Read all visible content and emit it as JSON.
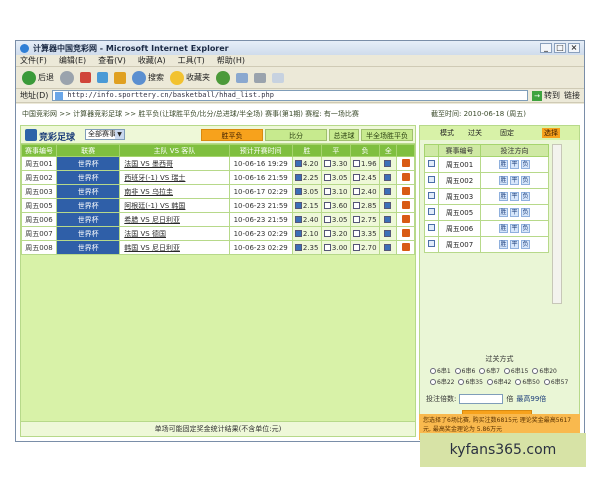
{
  "browser": {
    "title": "计算器中国竞彩网 - Microsoft Internet Explorer",
    "menu": [
      "文件(F)",
      "编辑(E)",
      "查看(V)",
      "收藏(A)",
      "工具(T)",
      "帮助(H)"
    ],
    "toolbar": {
      "back": "后退",
      "search": "搜索",
      "favorites": "收藏夹"
    },
    "address_label": "地址(D)",
    "url": "http://info.sporttery.cn/basketball/hhad_list.php",
    "go": "转到",
    "links": "链接"
  },
  "page": {
    "breadcrumb": "中国竞彩网 >> 计算器竞彩足球 >> 胜平负(让球胜平负/比分/总进球/半全场) 赛事(第1期)  赛程:  有一场比赛",
    "period": "截至时间: 2010-06-18 (周五)"
  },
  "left_panel": {
    "logo": "竞彩足球",
    "date_select": "全部赛事",
    "buttons": [
      "胜平负",
      "比分",
      "总进球",
      "半全场胜平负"
    ],
    "columns": [
      "赛事编号",
      "联赛",
      "主队 VS 客队",
      "预计开赛时间",
      "胜",
      "平",
      "负",
      "全",
      ""
    ],
    "rows": [
      {
        "num": "周五001",
        "league": "世界杯",
        "match": "法国 VS 墨西哥",
        "time": "10-06-16 19:29",
        "w": "4.20",
        "d": "3.30",
        "l": "1.96"
      },
      {
        "num": "周五002",
        "league": "世界杯",
        "match": "西班牙(-1) VS 瑞士",
        "time": "10-06-16 21:59",
        "w": "2.25",
        "d": "3.05",
        "l": "2.45"
      },
      {
        "num": "周五003",
        "league": "世界杯",
        "match": "南非 VS 乌拉圭",
        "time": "10-06-17 02:29",
        "w": "3.05",
        "d": "3.10",
        "l": "2.40"
      },
      {
        "num": "周五005",
        "league": "世界杯",
        "match": "阿根廷(-1) VS 韩国",
        "time": "10-06-23 21:59",
        "w": "2.15",
        "d": "3.60",
        "l": "2.85"
      },
      {
        "num": "周五006",
        "league": "世界杯",
        "match": "希腊 VS 尼日利亚",
        "time": "10-06-23 21:59",
        "w": "2.40",
        "d": "3.05",
        "l": "2.75"
      },
      {
        "num": "周五007",
        "league": "世界杯",
        "match": "法国 VS 德国",
        "time": "10-06-23 02:29",
        "w": "2.10",
        "d": "3.20",
        "l": "3.35"
      },
      {
        "num": "周五008",
        "league": "世界杯",
        "match": "韩国 VS 尼日利亚",
        "time": "10-06-23 02:29",
        "w": "2.35",
        "d": "3.00",
        "l": "2.70"
      }
    ],
    "footer": "单场可能固定奖金统计结果(不含单位:元)"
  },
  "right_panel": {
    "tabs": [
      "模式",
      "过关",
      "固定",
      "选择"
    ],
    "columns": [
      "",
      "赛事编号",
      "投注方向"
    ],
    "picks": [
      "胜",
      "平",
      "负"
    ],
    "rows": [
      "周五001",
      "周五002",
      "周五003",
      "周五005",
      "周五006",
      "周五007"
    ],
    "ggl": "过关方式",
    "radios": [
      "6串1",
      "6串6",
      "6串7",
      "6串15",
      "6串20",
      "6串22",
      "6串35",
      "6串42",
      "6串50",
      "6串57"
    ],
    "multiplier_label": "投注倍数:",
    "multiplier_unit": "倍",
    "multiplier_max": "最高99倍",
    "calc_button": "计算奖金",
    "info": "您选择了6场比赛, 购买注数6815元 理论奖金最高5617元, 最高奖金理论为 5.86万元"
  },
  "watermark": "kyfans365.com"
}
